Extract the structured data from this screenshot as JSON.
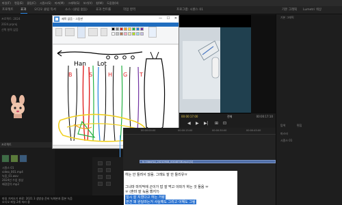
{
  "menubar": {
    "items": [
      "파일(F)",
      "편집(E)",
      "클립(C)",
      "시퀀스(S)",
      "마커(M)",
      "그래픽(G)",
      "보기(V)",
      "창(W)",
      "도움말(H)"
    ],
    "path": "C:/Program Files/Adobe/Adobe Premiere Pro 2020"
  },
  "tabs": {
    "left_a": "프로젝트",
    "left_b": "효과",
    "left_c": "오디오 클립 믹서",
    "left_d": "소스: (클립 없음)",
    "mid_a": "효과 컨트롤",
    "mid_b": "작업 영역",
    "program": "프로그램: 시퀀스 01",
    "right_a": "기본 그래픽",
    "right_b": "Lumetri 색상",
    "right_c": "탐색",
    "right_d": "편집"
  },
  "paint": {
    "title": "제목 없음 - 그림판",
    "window_buttons": [
      "—",
      "☐",
      "✕"
    ]
  },
  "monitor": {
    "timecode_left": "00:00:17:00",
    "fit_label": "전체",
    "timecode_right": "00:00:17:10"
  },
  "transport": {
    "buttons": [
      "◀",
      "▶",
      "▶|",
      "⊞",
      "⊡"
    ]
  },
  "project_panel": {
    "header": "프로젝트: 2024",
    "meta_lines": [
      "2024.prproj",
      "선택 항목 없음"
    ],
    "files": [
      "시퀀스 01",
      "video_001.mp4",
      "녹음_01.wav",
      "2024년 수업 영상",
      "배경음악.mp3"
    ]
  },
  "timeline": {
    "ruler": [
      "00:00:00:00",
      "00:00:15:00",
      "00:00:30:00",
      "00:00:45:00"
    ],
    "clip_label": "fx  Video%4_20210908_00048708.mp4 [V]"
  },
  "far_right": {
    "labels": [
      "기본 그래픽",
      "탐색",
      "편집",
      "마스터",
      "시퀀스 01"
    ]
  },
  "bottom_log": {
    "line1": "파일 가져오기 완료: 2021 3 생방송 준비 녹화본과 합본 녹음",
    "line2": "오디오 파일 2개 처리 중"
  },
  "chat": {
    "lines": [
      "하는 안 들려서 않음. 그래도 잘 안 들리유ㅠ",
      "그냐마 마지막에 곤이가 밥 잘 먹고 이따가 하는 것 들음 ㅠ",
      "ㅠ (혼마 잘 녹음 했지?)",
      "일시 잘 지켰다고 하는 거랑",
      "편견 꽤 완달라는거 사실해도 그리고 이해도 그림"
    ]
  },
  "colors": {
    "accent": "#2d8ceb",
    "clip": "#4f6fa8",
    "paint_ribbon_tab": "#1f6dbf",
    "chat_highlight": "#2b73d1"
  }
}
